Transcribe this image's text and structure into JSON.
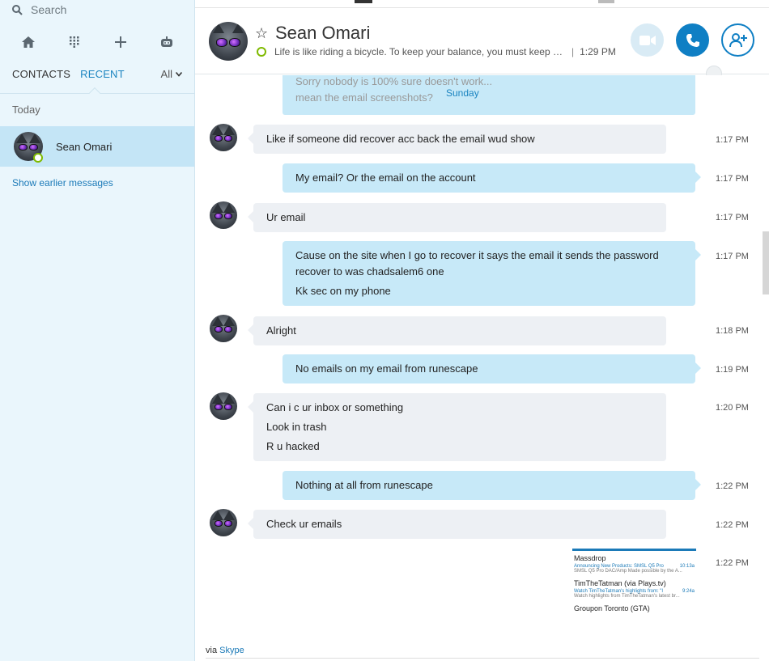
{
  "sidebar": {
    "search_placeholder": "Search",
    "nav_icons": [
      "home-icon",
      "dialpad-icon",
      "add-icon",
      "bot-icon"
    ],
    "tabs": [
      {
        "label": "CONTACTS",
        "active": false
      },
      {
        "label": "RECENT",
        "active": true
      }
    ],
    "filter_label": "All",
    "section_label": "Today",
    "contacts": [
      {
        "name": "Sean Omari",
        "status": "online"
      }
    ],
    "show_earlier": "Show earlier messages"
  },
  "header": {
    "name": "Sean Omari",
    "mood": "Life is like riding a bicycle. To keep your balance, you must keep m...",
    "time": "1:29 PM",
    "buttons": {
      "video": "video-call-icon",
      "call": "phone-icon",
      "add": "add-person-icon"
    }
  },
  "chat": {
    "partial_top_text": "Sorry nobody is 100% sure doesn't work...\nmean the email screenshots?",
    "date_divider": "Sunday",
    "messages": [
      {
        "dir": "in",
        "lines": [
          "Like if someone did recover acc back the email wud show"
        ],
        "time": "1:17 PM"
      },
      {
        "dir": "out",
        "lines": [
          "My email? Or the email on the account"
        ],
        "time": "1:17 PM"
      },
      {
        "dir": "in",
        "lines": [
          "Ur email"
        ],
        "time": "1:17 PM"
      },
      {
        "dir": "out",
        "lines": [
          "Cause on the site when I go to recover it says the email it sends the password recover to was chadsalem6 one",
          "Kk sec on my phone"
        ],
        "time": "1:17 PM"
      },
      {
        "dir": "in",
        "lines": [
          "Alright"
        ],
        "time": "1:18 PM"
      },
      {
        "dir": "out",
        "lines": [
          "No emails on my email from runescape"
        ],
        "time": "1:19 PM"
      },
      {
        "dir": "in",
        "lines": [
          "Can i c ur inbox or something",
          "Look in trash",
          "R u hacked"
        ],
        "time": "1:20 PM"
      },
      {
        "dir": "out",
        "lines": [
          "Nothing at all from runescape"
        ],
        "time": "1:22 PM"
      },
      {
        "dir": "in",
        "lines": [
          "Check ur emails"
        ],
        "time": "1:22 PM"
      }
    ],
    "image_time": "1:22 PM",
    "image_emails": [
      {
        "sender": "Massdrop",
        "subject": "Announcing New Products: SMSL Q5 Pro",
        "stamp": "10:13a",
        "preview": "SMSL Q5 Pro DAC/Amp Made possible by the A..."
      },
      {
        "sender": "TimTheTatman (via Plays.tv)",
        "subject": "Watch TimTheTatman's highlights from: \"I",
        "stamp": "9:24a",
        "preview": "Watch highlights from TimTheTatman's latest br..."
      },
      {
        "sender": "Groupon Toronto (GTA)",
        "subject": "",
        "stamp": "",
        "preview": ""
      }
    ]
  },
  "footer": {
    "via": "via",
    "via_link": "Skype"
  }
}
